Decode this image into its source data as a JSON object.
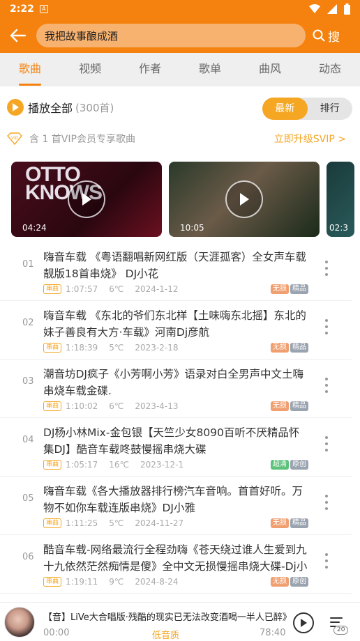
{
  "status": {
    "time": "2:22",
    "notif_glyph": "A"
  },
  "search": {
    "query": "我把故事酿成酒",
    "button": "搜"
  },
  "tabs": [
    "歌曲",
    "视频",
    "作者",
    "歌单",
    "曲风",
    "动态"
  ],
  "play_all": {
    "label": "播放全部",
    "count": "(300首)"
  },
  "sort": {
    "latest": "最新",
    "ranking": "排行"
  },
  "vip": {
    "badge": "VIP",
    "text": "含 1 首VIP会员专享歌曲",
    "upgrade": "立即升级SVIP >"
  },
  "videos": [
    {
      "title": "OTTO KNOWS",
      "duration": "04:24"
    },
    {
      "title": "",
      "duration": "10:05"
    },
    {
      "title": "",
      "duration": "02:3"
    }
  ],
  "songs": [
    {
      "num": "01",
      "title": "嗨音车载 《粤语翻唱新网红版（天涯孤客）全女声车载靓版18首串烧》 DJ小花",
      "tag": "串曲",
      "duration": "1:07:57",
      "temp": "6℃",
      "date": "2024-1-12",
      "badges": [
        "无损",
        "精品"
      ]
    },
    {
      "num": "02",
      "title": "嗨音车载 《东北的爷们东北样【土味嗨东北摇】东北的妹子善良有大方·车载》河南Dj彦航",
      "tag": "串曲",
      "duration": "1:18:39",
      "temp": "5℃",
      "date": "2023-2-18",
      "badges": [
        "无损",
        "精品"
      ]
    },
    {
      "num": "03",
      "title": "潮音坊DJ疯子《小芳啊小芳》语录对白全男声中文土嗨串烧车载金碟.",
      "tag": "串曲",
      "duration": "1:10:02",
      "temp": "6℃",
      "date": "2023-4-13",
      "badges": [
        "无损",
        "精品"
      ]
    },
    {
      "num": "04",
      "title": "DJ杨小林Mix-金包银【天竺少女8090百听不厌精品怀集DJ】酷音车载咚鼓慢摇串烧大碟",
      "tag": "串曲",
      "duration": "1:05:17",
      "temp": "16℃",
      "date": "2023-12-1",
      "badges": [
        "超清",
        "原创"
      ]
    },
    {
      "num": "05",
      "title": "嗨音车载《各大播放器排行榜汽车音响。首首好听。万物不如你车载连版串烧》DJ小雅",
      "tag": "串曲",
      "duration": "1:11:25",
      "temp": "5℃",
      "date": "2024-11-27",
      "badges": [
        "无损",
        "精品"
      ]
    },
    {
      "num": "06",
      "title": "酷音车载-网络最流行全程劲嗨《苍天绕过谁人生爱到九十九依然茫然痴情是傻》全中文无损慢摇串烧大碟-Dj小峰",
      "tag": "串曲",
      "duration": "1:19:11",
      "temp": "9℃",
      "date": "2024-8-24",
      "badges": [
        "无损",
        "原创"
      ]
    }
  ],
  "player": {
    "title": "【音】LiVe大合唱版·残酷的现实已无法改变酒喝一半人已醉》",
    "start": "00:00",
    "quality": "低音质",
    "end": "78:40",
    "queue_count": "20"
  },
  "colors": {
    "accent": "#f5820e",
    "accent_light": "#f5a623"
  }
}
